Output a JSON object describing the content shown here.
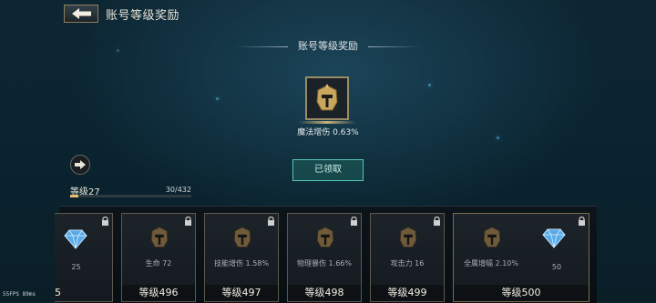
{
  "header": {
    "title": "账号等级奖励"
  },
  "reward": {
    "section_title": "账号等级奖励",
    "label": "魔法增伤 0.63%",
    "claimed_button": "已领取"
  },
  "progress": {
    "level_label": "等级27",
    "exp_text": "30/432",
    "exp_current": 30,
    "exp_max": 432
  },
  "cards": [
    {
      "stat": "25",
      "level_text": "5",
      "icon": "diamond-icon"
    },
    {
      "stat": "生命 72",
      "level_text": "等级496",
      "icon": "helmet-icon"
    },
    {
      "stat": "技能增伤 1.58%",
      "level_text": "等级497",
      "icon": "helmet-icon"
    },
    {
      "stat": "物理暴伤 1.66%",
      "level_text": "等级498",
      "icon": "helmet-icon"
    },
    {
      "stat": "攻击力 16",
      "level_text": "等级499",
      "icon": "helmet-icon"
    },
    {
      "stat_left": "全属增幅 2.10%",
      "stat_right": "50",
      "level_text": "等级500",
      "icons": [
        "helmet-icon",
        "diamond-icon"
      ]
    }
  ],
  "debug": {
    "fps_text": "55FPS   89ms"
  },
  "colors": {
    "accent_gold": "#c8b17a",
    "claimed_border": "#57c7b4",
    "exp_fill": "#e8c070",
    "background": "#0d2633"
  }
}
